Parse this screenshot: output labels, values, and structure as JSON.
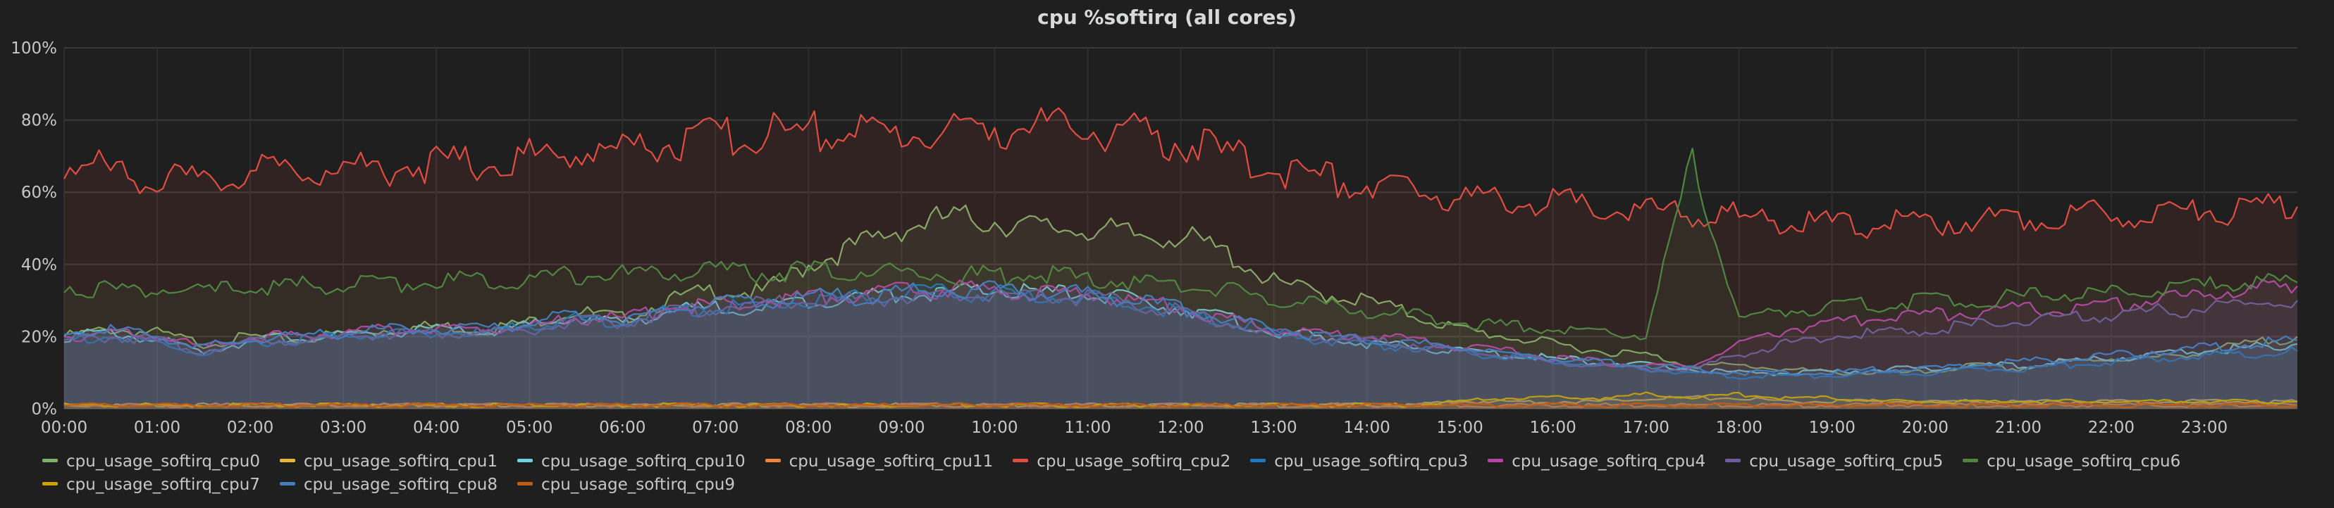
{
  "panel": {
    "title": "cpu %softirq (all cores)"
  },
  "chart_data": {
    "type": "area",
    "title": "cpu %softirq (all cores)",
    "y_ticks": [
      "0%",
      "20%",
      "40%",
      "60%",
      "80%",
      "100%"
    ],
    "ylim": [
      0,
      100
    ],
    "y_unit": "%",
    "x_ticks": [
      "00:00",
      "01:00",
      "02:00",
      "03:00",
      "04:00",
      "05:00",
      "06:00",
      "07:00",
      "08:00",
      "09:00",
      "10:00",
      "11:00",
      "12:00",
      "13:00",
      "14:00",
      "15:00",
      "16:00",
      "17:00",
      "18:00",
      "19:00",
      "20:00",
      "21:00",
      "22:00",
      "23:00"
    ],
    "xlim_hours": [
      0,
      24
    ],
    "grid": true,
    "legend_position": "bottom",
    "x_hours": [
      0,
      0.5,
      1,
      1.5,
      2,
      2.5,
      3,
      3.5,
      4,
      4.5,
      5,
      5.5,
      6,
      6.5,
      7,
      7.5,
      8,
      8.5,
      9,
      9.5,
      10,
      10.5,
      11,
      11.5,
      12,
      12.5,
      13,
      13.5,
      14,
      14.5,
      15,
      15.5,
      16,
      16.5,
      17,
      17.5,
      18,
      18.5,
      19,
      19.5,
      20,
      20.5,
      21,
      21.5,
      22,
      22.5,
      23,
      23.5,
      24
    ],
    "series": [
      {
        "name": "cpu_usage_softirq_cpu0",
        "color": "#7eb26d",
        "values": [
          20,
          22,
          21,
          18,
          20,
          19,
          21,
          22,
          23,
          22,
          24,
          27,
          25,
          30,
          33,
          32,
          40,
          45,
          50,
          53,
          52,
          50,
          50,
          48,
          48,
          43,
          35,
          32,
          30,
          26,
          22,
          20,
          18,
          16,
          15,
          12,
          12,
          11,
          10,
          10,
          10,
          12,
          11,
          13,
          14,
          14,
          16,
          18,
          20
        ]
      },
      {
        "name": "cpu_usage_softirq_cpu1",
        "color": "#eab839",
        "values": [
          1,
          1,
          1,
          1,
          1,
          1,
          1,
          1,
          1,
          1,
          1,
          1,
          1,
          1,
          1,
          1,
          1,
          1,
          1,
          1,
          1,
          1,
          1,
          1,
          1,
          1,
          1,
          1,
          1,
          1,
          2,
          2,
          2,
          2,
          3,
          3,
          3,
          2,
          2,
          2,
          2,
          2,
          2,
          2,
          2,
          2,
          2,
          2,
          2
        ]
      },
      {
        "name": "cpu_usage_softirq_cpu10",
        "color": "#6ed0e0",
        "values": [
          20,
          21,
          19,
          16,
          19,
          20,
          20,
          21,
          22,
          21,
          23,
          25,
          24,
          27,
          28,
          28,
          30,
          31,
          32,
          32,
          33,
          32,
          32,
          30,
          28,
          25,
          21,
          20,
          18,
          17,
          16,
          15,
          14,
          13,
          12,
          11,
          10,
          10,
          10,
          11,
          11,
          12,
          12,
          13,
          14,
          15,
          16,
          17,
          18
        ]
      },
      {
        "name": "cpu_usage_softirq_cpu11",
        "color": "#ef843c",
        "values": [
          1,
          1,
          1,
          1,
          1,
          1,
          1,
          1,
          1,
          1,
          1,
          1,
          1,
          1,
          1,
          1,
          1,
          1,
          1,
          1,
          1,
          1,
          1,
          1,
          1,
          1,
          1,
          1,
          1,
          1,
          1,
          1,
          1,
          1,
          1,
          1,
          1,
          1,
          1,
          1,
          1,
          1,
          1,
          1,
          1,
          1,
          1,
          1,
          1
        ]
      },
      {
        "name": "cpu_usage_softirq_cpu2",
        "color": "#e24d42",
        "values": [
          68,
          66,
          64,
          62,
          66,
          66,
          67,
          67,
          68,
          68,
          70,
          71,
          72,
          74,
          75,
          76,
          77,
          77,
          76,
          77,
          78,
          78,
          77,
          76,
          74,
          70,
          67,
          64,
          62,
          60,
          59,
          58,
          57,
          56,
          55,
          54,
          53,
          52,
          51,
          51,
          52,
          52,
          53,
          54,
          54,
          55,
          55,
          55,
          56
        ]
      },
      {
        "name": "cpu_usage_softirq_cpu3",
        "color": "#1f78c1",
        "values": [
          19,
          20,
          18,
          15,
          18,
          19,
          20,
          21,
          21,
          21,
          23,
          25,
          24,
          27,
          28,
          29,
          30,
          31,
          32,
          32,
          32,
          31,
          31,
          29,
          27,
          24,
          21,
          19,
          18,
          17,
          16,
          14,
          13,
          12,
          11,
          10,
          9,
          9,
          9,
          10,
          10,
          11,
          11,
          12,
          13,
          14,
          15,
          15,
          16
        ]
      },
      {
        "name": "cpu_usage_softirq_cpu4",
        "color": "#ba43a9",
        "values": [
          20,
          21,
          20,
          17,
          20,
          20,
          21,
          22,
          22,
          22,
          23,
          25,
          25,
          28,
          29,
          30,
          31,
          32,
          33,
          33,
          33,
          32,
          32,
          30,
          28,
          25,
          22,
          21,
          20,
          19,
          17,
          16,
          14,
          13,
          12,
          12,
          18,
          22,
          24,
          25,
          26,
          27,
          28,
          28,
          29,
          30,
          32,
          33,
          34
        ]
      },
      {
        "name": "cpu_usage_softirq_cpu5",
        "color": "#705da0",
        "values": [
          19,
          20,
          19,
          16,
          19,
          19,
          20,
          21,
          21,
          21,
          22,
          24,
          24,
          27,
          28,
          29,
          30,
          30,
          31,
          31,
          32,
          31,
          31,
          29,
          27,
          24,
          21,
          20,
          19,
          18,
          16,
          15,
          13,
          12,
          11,
          11,
          15,
          18,
          20,
          21,
          22,
          23,
          24,
          25,
          26,
          27,
          28,
          29,
          30
        ]
      },
      {
        "name": "cpu_usage_softirq_cpu6",
        "color": "#508642",
        "values": [
          34,
          33,
          33,
          32,
          34,
          34,
          34,
          35,
          35,
          36,
          36,
          37,
          37,
          38,
          38,
          38,
          38,
          38,
          38,
          37,
          37,
          37,
          36,
          35,
          34,
          33,
          30,
          29,
          27,
          26,
          24,
          23,
          22,
          22,
          20,
          68,
          25,
          27,
          28,
          29,
          30,
          30,
          31,
          32,
          32,
          33,
          34,
          35,
          35
        ]
      },
      {
        "name": "cpu_usage_softirq_cpu7",
        "color": "#cca300",
        "values": [
          1,
          1,
          1,
          1,
          1,
          1,
          1,
          1,
          1,
          1,
          1,
          1,
          1,
          1,
          1,
          1,
          1,
          1,
          1,
          1,
          1,
          1,
          1,
          1,
          1,
          1,
          1,
          1,
          1,
          1,
          2,
          3,
          3,
          3,
          4,
          3,
          4,
          3,
          3,
          2,
          2,
          2,
          2,
          2,
          2,
          2,
          2,
          2,
          2
        ]
      },
      {
        "name": "cpu_usage_softirq_cpu8",
        "color": "#447ebc",
        "values": [
          21,
          22,
          20,
          17,
          19,
          20,
          21,
          22,
          22,
          22,
          24,
          26,
          25,
          28,
          29,
          30,
          31,
          31,
          32,
          33,
          33,
          32,
          32,
          30,
          28,
          25,
          22,
          20,
          19,
          18,
          17,
          15,
          14,
          13,
          12,
          11,
          10,
          10,
          10,
          11,
          11,
          12,
          13,
          14,
          15,
          16,
          17,
          18,
          19
        ]
      },
      {
        "name": "cpu_usage_softirq_cpu9",
        "color": "#c15c17",
        "values": [
          1,
          1,
          1,
          1,
          1,
          1,
          1,
          1,
          1,
          1,
          1,
          1,
          1,
          1,
          1,
          1,
          1,
          1,
          1,
          1,
          1,
          1,
          1,
          1,
          1,
          1,
          1,
          1,
          1,
          1,
          1,
          1,
          1,
          1,
          1,
          1,
          1,
          1,
          1,
          1,
          1,
          1,
          1,
          1,
          1,
          1,
          1,
          1,
          1
        ]
      }
    ]
  }
}
